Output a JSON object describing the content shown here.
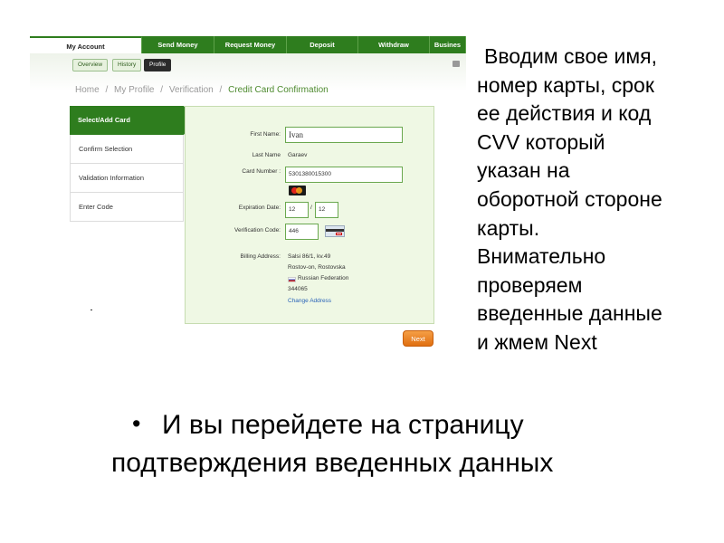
{
  "screenshot": {
    "nav_tabs": [
      "My Account",
      "Send Money",
      "Request Money",
      "Deposit",
      "Withdraw",
      "Busines"
    ],
    "sub_tabs": [
      "Overview",
      "History",
      "Profile"
    ],
    "breadcrumb": {
      "items": [
        "Home",
        "My Profile",
        "Verification"
      ],
      "separator": "/",
      "current": "Credit Card Confirmation"
    },
    "side_menu": [
      "Select/Add Card",
      "Confirm Selection",
      "Validation Information",
      "Enter Code"
    ],
    "form": {
      "first_name_label": "First Name:",
      "first_name_value": "Ivan",
      "last_name_label": "Last Name",
      "last_name_value": "Garaev",
      "card_number_label": "Card Number :",
      "card_number_value": "5301380015300",
      "expiration_label": "Expiration Date:",
      "exp_month": "12",
      "exp_separator": "/",
      "exp_year": "12",
      "verification_label": "Verification Code:",
      "verification_value": "446",
      "billing_label": "Billing Address:",
      "billing_lines": [
        "Salsi 86/1, kv.49",
        "Rostov-on, Rostovska",
        "Russian Federation",
        "344065"
      ],
      "change_address": "Change Address",
      "card_brand_icon": "mastercard-icon",
      "cvv_icon": "card-back-cvv-icon",
      "country_flag_icon": "russia-flag-icon"
    },
    "next_label": "Next",
    "colors": {
      "nav_green": "#2e7d1e",
      "panel_bg": "#eff8e4",
      "next_orange": "#e8801f",
      "link_blue": "#2a63b8"
    }
  },
  "instruction_lines": [
    "Вводим свое имя,",
    "номер карты, срок",
    "ее действия и код",
    "CVV который",
    "указан на",
    "оборотной стороне",
    "карты.",
    "Внимательно",
    "проверяем",
    "введенные данные",
    "и жмем Next"
  ],
  "bullet": {
    "marker": "•",
    "lines": [
      "И вы перейдете на страницу",
      "подтверждения введенных данных"
    ]
  }
}
